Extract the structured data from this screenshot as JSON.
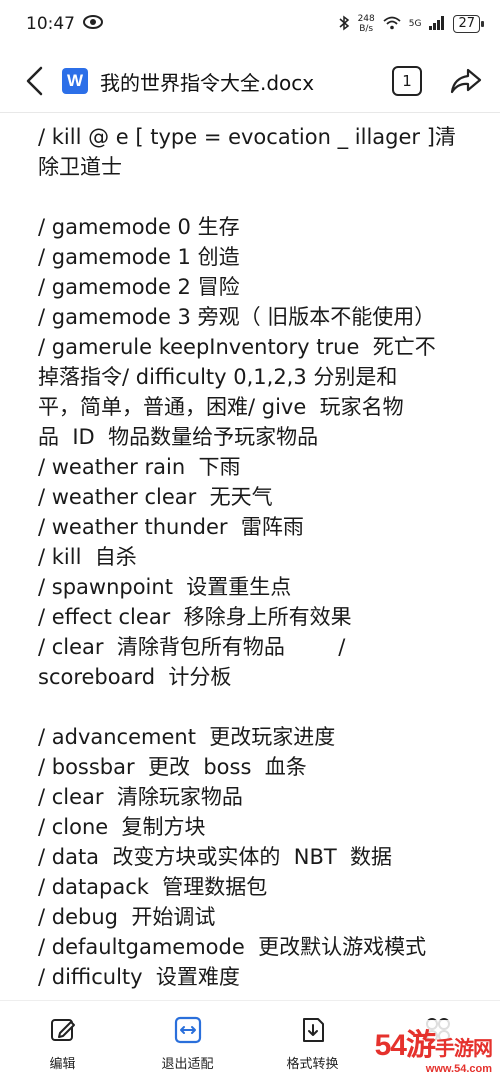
{
  "status_bar": {
    "time": "10:47",
    "net_speed_value": "248",
    "net_speed_unit": "B/s",
    "network": "5G",
    "battery": "27"
  },
  "title_bar": {
    "app_icon_letter": "W",
    "document_title": "我的世界指令大全.docx",
    "page_count": "1"
  },
  "document": {
    "lines": [
      "/ kill @ e [ type = evocation _ illager ]清",
      "除卫道士",
      "",
      "/ gamemode 0 生存",
      "/ gamemode 1 创造",
      "/ gamemode 2 冒险",
      "/ gamemode 3 旁观（ 旧版本不能使用）",
      "/ gamerule keepInventory true  死亡不",
      "掉落指令/ difficulty 0,1,2,3 分别是和",
      "平，简单，普通，困难/ give  玩家名物",
      "品  ID  物品数量给予玩家物品",
      "/ weather rain  下雨",
      "/ weather clear  无天气",
      "/ weather thunder  雷阵雨",
      "/ kill  自杀",
      "/ spawnpoint  设置重生点",
      "/ effect clear  移除身上所有效果",
      "/ clear  清除背包所有物品        /",
      "scoreboard  计分板",
      "",
      "/ advancement  更改玩家进度",
      "/ bossbar  更改  boss  血条",
      "/ clear  清除玩家物品",
      "/ clone  复制方块",
      "/ data  改变方块或实体的  NBT  数据",
      "/ datapack  管理数据包",
      "/ debug  开始调试",
      "/ defaultgamemode  更改默认游戏模式",
      "/ difficulty  设置难度"
    ]
  },
  "bottom_bar": {
    "edit_label": "编辑",
    "exit_fit_label": "退出适配",
    "convert_label": "格式转换"
  },
  "watermark": {
    "text": "54游",
    "sub": "www.54.com",
    "site": "手游网"
  },
  "colors": {
    "word_blue": "#2c6fe8",
    "accent_blue": "#2a6fdb",
    "watermark_red": "#e5322d"
  }
}
